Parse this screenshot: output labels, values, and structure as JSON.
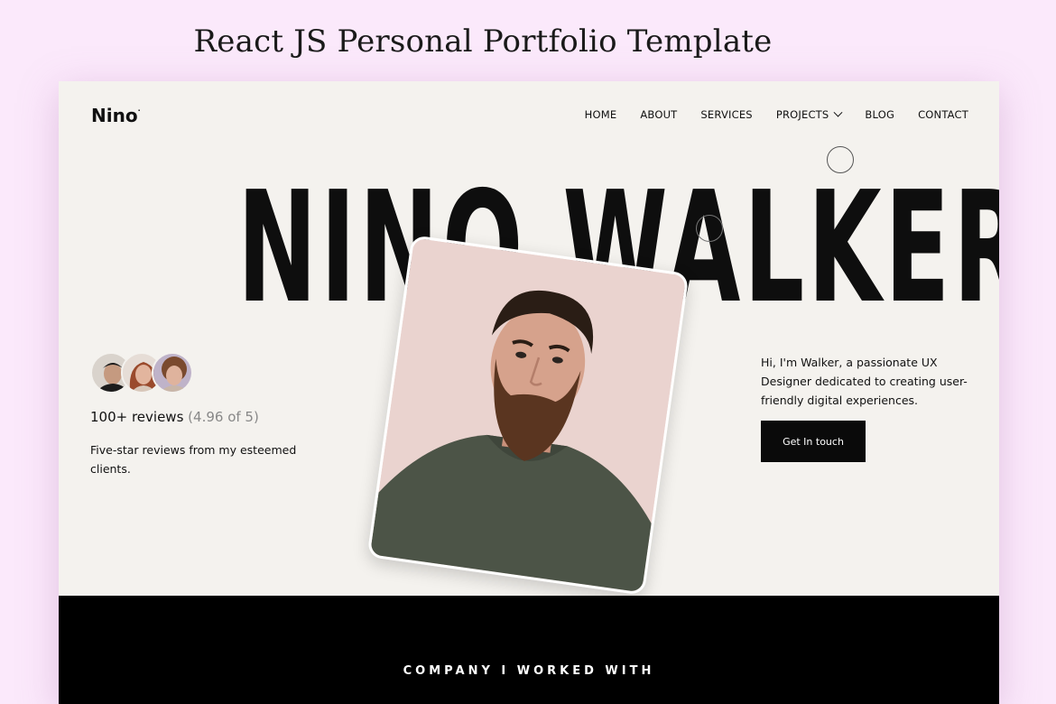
{
  "page": {
    "heading": "React JS Personal Portfolio Template"
  },
  "brand": {
    "logo": "Nino",
    "logo_mark": "·"
  },
  "nav": {
    "items": [
      {
        "label": "HOME"
      },
      {
        "label": "ABOUT"
      },
      {
        "label": "SERVICES"
      },
      {
        "label": "PROJECTS",
        "has_dropdown": true
      },
      {
        "label": "BLOG"
      },
      {
        "label": "CONTACT"
      }
    ]
  },
  "hero": {
    "name": "NINO WALKER",
    "reviews": {
      "count": "100+ reviews",
      "rating": "(4.96 of 5)",
      "description": "Five-star reviews from my esteemed clients."
    },
    "intro": "Hi, I'm Walker, a passionate UX Designer dedicated to creating user-friendly digital experiences.",
    "cta_label": "Get In touch"
  },
  "companies": {
    "title": "COMPANY I WORKED WITH"
  },
  "colors": {
    "page_bg": "#fbe9fb",
    "frame_bg": "#f4f2ee",
    "accent": "#0a0a0a"
  }
}
